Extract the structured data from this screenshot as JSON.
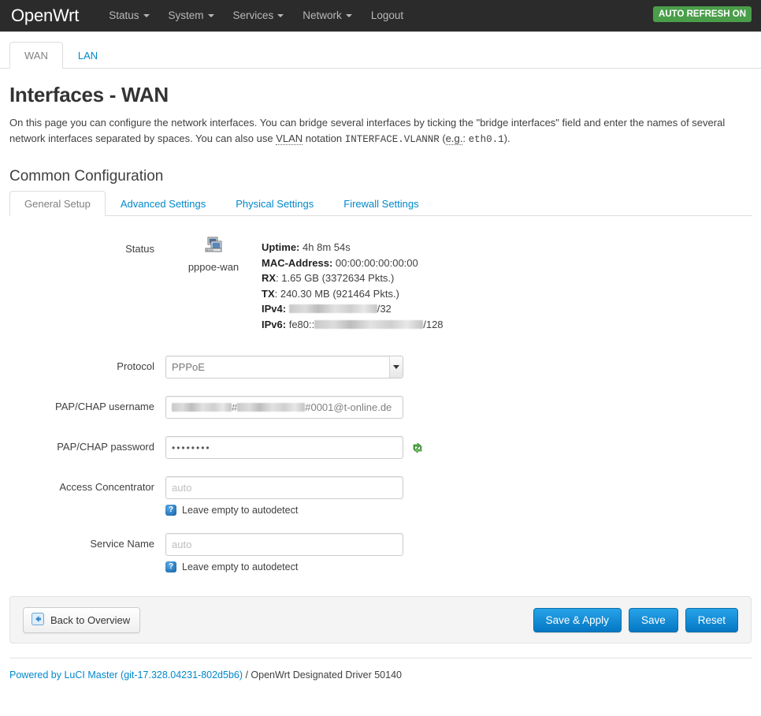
{
  "topnav": {
    "brand": "OpenWrt",
    "items": [
      {
        "label": "Status",
        "has_caret": true
      },
      {
        "label": "System",
        "has_caret": true
      },
      {
        "label": "Services",
        "has_caret": true
      },
      {
        "label": "Network",
        "has_caret": true
      },
      {
        "label": "Logout",
        "has_caret": false
      }
    ],
    "auto_refresh": "AUTO REFRESH ON",
    "auto_refresh_color": "#4a9e4a",
    "bar_color": "#2b2b2b"
  },
  "page_tabs": [
    {
      "label": "WAN",
      "active": true
    },
    {
      "label": "LAN",
      "active": false
    }
  ],
  "page": {
    "title": "Interfaces - WAN",
    "description_part1": "On this page you can configure the network interfaces. You can bridge several interfaces by ticking the \"bridge interfaces\" field and enter the names of several network interfaces separated by spaces. You can also use ",
    "description_vlan": "VLAN",
    "description_part2": " notation ",
    "description_code1": "INTERFACE.VLANNR",
    "description_part3": " (",
    "description_eg": "e.g.",
    "description_part4": ": ",
    "description_code2": "eth0.1",
    "description_part5": ")."
  },
  "section": {
    "title": "Common Configuration",
    "tabs": [
      {
        "label": "General Setup",
        "active": true
      },
      {
        "label": "Advanced Settings",
        "active": false
      },
      {
        "label": "Physical Settings",
        "active": false
      },
      {
        "label": "Firewall Settings",
        "active": false
      }
    ]
  },
  "status": {
    "label": "Status",
    "interface_icon": "ethernet-interface-icon",
    "interface_name": "pppoe-wan",
    "fields": [
      {
        "key": "Uptime:",
        "value": "4h 8m 54s"
      },
      {
        "key": "MAC-Address:",
        "value": "00:00:00:00:00:00"
      },
      {
        "key": "RX",
        "value": ": 1.65 GB (3372634 Pkts.)"
      },
      {
        "key": "TX",
        "value": ": 240.30 MB (921464 Pkts.)"
      }
    ],
    "ipv4_key": "IPv4:",
    "ipv4_value_redacted": true,
    "ipv4_suffix": "/32",
    "ipv6_key": "IPv6:",
    "ipv6_prefix": "fe80::",
    "ipv6_value_redacted": true,
    "ipv6_suffix": "/128"
  },
  "form": {
    "protocol": {
      "label": "Protocol",
      "value": "PPPoE",
      "options": [
        "PPPoE"
      ]
    },
    "username": {
      "label": "PAP/CHAP username",
      "value_visible_tail": "#0001@t-online.de",
      "value_mid_separator": "#",
      "redacted": true
    },
    "password": {
      "label": "PAP/CHAP password",
      "value": "••••••••",
      "reveal_icon": "reload-password-icon"
    },
    "access_concentrator": {
      "label": "Access Concentrator",
      "value": "",
      "placeholder": "auto",
      "hint": "Leave empty to autodetect"
    },
    "service_name": {
      "label": "Service Name",
      "value": "",
      "placeholder": "auto",
      "hint": "Leave empty to autodetect"
    }
  },
  "actions": {
    "back_label": "Back to Overview",
    "back_icon": "back-arrow-icon",
    "save_apply_label": "Save & Apply",
    "save_label": "Save",
    "reset_label": "Reset",
    "primary_color": "#0577c4"
  },
  "footer": {
    "link_text": "Powered by LuCI Master (git-17.328.04231-802d5b6)",
    "rest_text": " / OpenWrt Designated Driver 50140"
  }
}
